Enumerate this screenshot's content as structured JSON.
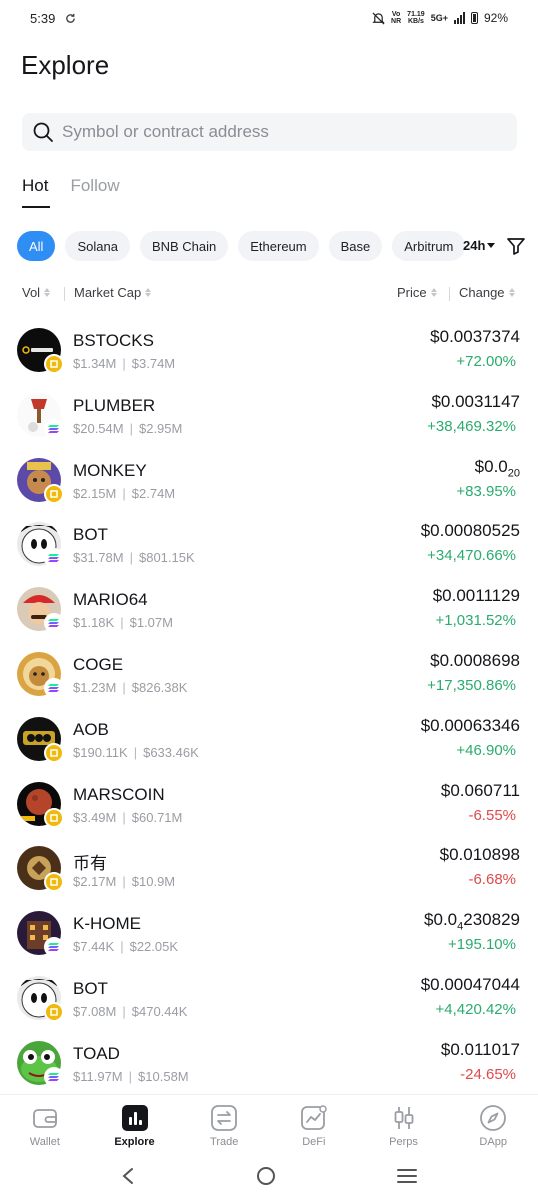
{
  "status": {
    "time": "5:39",
    "vo_top": "Vo",
    "vo_bottom": "NR",
    "speed_top": "71.19",
    "speed_bottom": "KB/s",
    "network": "5G+",
    "battery": "92%"
  },
  "page": {
    "title": "Explore"
  },
  "search": {
    "placeholder": "Symbol or contract address"
  },
  "tabs": [
    {
      "label": "Hot"
    },
    {
      "label": "Follow"
    }
  ],
  "chains": [
    {
      "label": "All"
    },
    {
      "label": "Solana"
    },
    {
      "label": "BNB Chain"
    },
    {
      "label": "Ethereum"
    },
    {
      "label": "Base"
    },
    {
      "label": "Arbitrum"
    }
  ],
  "timeframe": "24h",
  "columns": {
    "vol": "Vol",
    "mcap": "Market Cap",
    "price": "Price",
    "change": "Change"
  },
  "tokens": [
    {
      "symbol": "BSTOCKS",
      "vol": "$1.34M",
      "mcap": "$3.74M",
      "price": "$0.0037374",
      "change": "+72.00%",
      "dir": "pos",
      "chain": "bnb"
    },
    {
      "symbol": "PLUMBER",
      "vol": "$20.54M",
      "mcap": "$2.95M",
      "price": "$0.0031147",
      "change": "+38,469.32%",
      "dir": "pos",
      "chain": "sol"
    },
    {
      "symbol": "MONKEY",
      "vol": "$2.15M",
      "mcap": "$2.74M",
      "price_main": "$0.0",
      "price_sub": "20",
      "change": "+83.95%",
      "dir": "pos",
      "chain": "bnb"
    },
    {
      "symbol": "BOT",
      "vol": "$31.78M",
      "mcap": "$801.15K",
      "price": "$0.00080525",
      "change": "+34,470.66%",
      "dir": "pos",
      "chain": "sol"
    },
    {
      "symbol": "MARIO64",
      "vol": "$1.18K",
      "mcap": "$1.07M",
      "price": "$0.0011129",
      "change": "+1,031.52%",
      "dir": "pos",
      "chain": "sol"
    },
    {
      "symbol": "COGE",
      "vol": "$1.23M",
      "mcap": "$826.38K",
      "price": "$0.0008698",
      "change": "+17,350.86%",
      "dir": "pos",
      "chain": "sol"
    },
    {
      "symbol": "AOB",
      "vol": "$190.11K",
      "mcap": "$633.46K",
      "price": "$0.00063346",
      "change": "+46.90%",
      "dir": "pos",
      "chain": "bnb"
    },
    {
      "symbol": "MARSCOIN",
      "vol": "$3.49M",
      "mcap": "$60.71M",
      "price": "$0.060711",
      "change": "-6.55%",
      "dir": "neg",
      "chain": "bnb"
    },
    {
      "symbol": "币有",
      "vol": "$2.17M",
      "mcap": "$10.9M",
      "price": "$0.010898",
      "change": "-6.68%",
      "dir": "neg",
      "chain": "bnb"
    },
    {
      "symbol": "K-HOME",
      "vol": "$7.44K",
      "mcap": "$22.05K",
      "price_main": "$0.0",
      "price_sub": "4",
      "price_tail": "230829",
      "change": "+195.10%",
      "dir": "pos",
      "chain": "sol"
    },
    {
      "symbol": "BOT",
      "vol": "$7.08M",
      "mcap": "$470.44K",
      "price": "$0.00047044",
      "change": "+4,420.42%",
      "dir": "pos",
      "chain": "bnb"
    },
    {
      "symbol": "TOAD",
      "vol": "$11.97M",
      "mcap": "$10.58M",
      "price": "$0.011017",
      "change": "-24.65%",
      "dir": "neg",
      "chain": "sol"
    }
  ],
  "bottom_nav": [
    {
      "label": "Wallet",
      "icon": "wallet-icon"
    },
    {
      "label": "Explore",
      "icon": "explore-icon"
    },
    {
      "label": "Trade",
      "icon": "trade-icon"
    },
    {
      "label": "DeFi",
      "icon": "defi-icon"
    },
    {
      "label": "Perps",
      "icon": "perps-icon"
    },
    {
      "label": "DApp",
      "icon": "dapp-icon"
    }
  ],
  "colors": {
    "accent": "#2f8ef4",
    "positive": "#2bab6e",
    "negative": "#e04949",
    "bnb": "#f0b90b"
  }
}
